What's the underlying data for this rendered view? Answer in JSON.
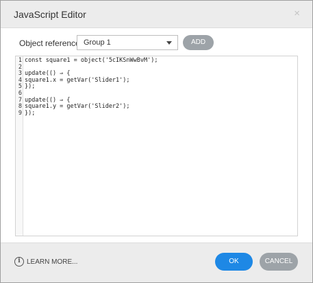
{
  "dialog": {
    "title": "JavaScript Editor",
    "close_glyph": "×"
  },
  "reference": {
    "label": "Object reference",
    "selected": "Group 1",
    "add_label": "ADD"
  },
  "editor": {
    "line_numbers": [
      "1",
      "2",
      "3",
      "4",
      "5",
      "6",
      "7",
      "8",
      "9"
    ],
    "lines": [
      "const square1 = object('5cIKSnWwBvM');",
      "",
      "update(() ⇒ {",
      "square1.x = getVar('Slider1');",
      "});",
      "",
      "update(() ⇒ {",
      "square1.y = getVar('Slider2');",
      "});"
    ]
  },
  "footer": {
    "learn_more": "LEARN MORE...",
    "info_glyph": "i",
    "ok_label": "OK",
    "cancel_label": "CANCEL"
  },
  "colors": {
    "primary": "#1e88e5",
    "secondary_button": "#9da3a8",
    "titlebar": "#ececec"
  },
  "icons": {
    "close": "close-icon",
    "dropdown": "chevron-down-icon",
    "info": "info-icon"
  }
}
